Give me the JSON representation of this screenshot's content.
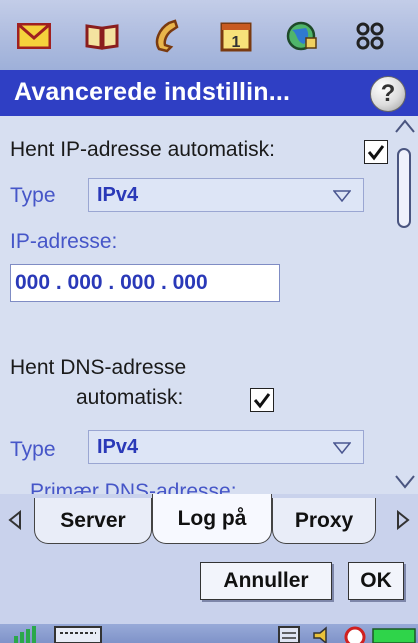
{
  "app_icons": [
    "envelope-icon",
    "book-icon",
    "phone-icon",
    "calendar-icon",
    "globe-icon",
    "apps-grid-icon"
  ],
  "title": "Avancerede indstillin...",
  "help_label": "?",
  "form": {
    "ip_auto_label": "Hent IP-adresse automatisk:",
    "ip_auto_checked": true,
    "type1_label": "Type",
    "type1_value": "IPv4",
    "ip_label": "IP-adresse:",
    "ip_value": "000 . 000 . 000 . 000",
    "dns_auto_label_line1": "Hent DNS-adresse",
    "dns_auto_label_line2": "automatisk:",
    "dns_auto_checked": true,
    "type2_label": "Type",
    "type2_value": "IPv4",
    "primary_dns_label": "Primær DNS-adresse:"
  },
  "tabs": [
    {
      "label": "Server",
      "active": false
    },
    {
      "label": "Log på",
      "active": true
    },
    {
      "label": "Proxy",
      "active": false
    }
  ],
  "buttons": {
    "cancel": "Annuller",
    "ok": "OK"
  },
  "status_icons": [
    "signal-icon",
    "keyboard-icon",
    "calculator-icon",
    "volume-icon",
    "clock-icon",
    "battery-icon"
  ]
}
